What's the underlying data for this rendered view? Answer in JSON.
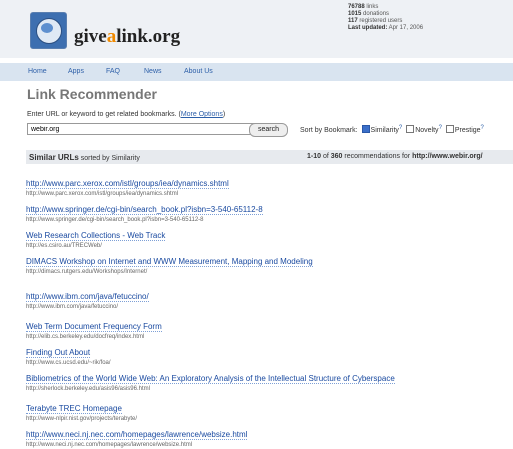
{
  "header": {
    "site_name_part1": "give",
    "site_name_part2": "a",
    "site_name_part3": "link.org",
    "stats": {
      "links": "76788",
      "links_label": " links",
      "donations": "1015",
      "donations_label": " donations",
      "users": "117",
      "users_label": " registered users",
      "updated_label": "Last updated:",
      "updated_value": " Apr 17, 2006"
    }
  },
  "nav": [
    "Home",
    "Apps",
    "FAQ",
    "News",
    "About Us"
  ],
  "page_title": "Link Recommender",
  "enter": {
    "prefix": "Enter URL or keyword to get related bookmarks. (",
    "link": "More Options",
    "suffix": ")"
  },
  "search": {
    "value": "webir.org",
    "button": "search"
  },
  "sort": {
    "label": "Sort by Bookmark:",
    "options": [
      {
        "label": "Similarity",
        "checked": true
      },
      {
        "label": "Novelty",
        "checked": false
      },
      {
        "label": "Prestige",
        "checked": false
      }
    ],
    "help": "?"
  },
  "results_header": {
    "title": "Similar URLs",
    "subtitle": " sorted by Similarity",
    "range": "1-10",
    "of": " of ",
    "total": "360",
    "mid": " recommendations for ",
    "target": "http://www.webir.org/"
  },
  "results": [
    {
      "title": "http://www.parc.xerox.com/istl/groups/iea/dynamics.shtml",
      "url": "http://www.parc.xerox.com/istl/groups/iea/dynamics.shtml"
    },
    {
      "title": "http://www.springer.de/cgi-bin/search_book.pl?isbn=3-540-65112-8",
      "url": "http://www.springer.de/cgi-bin/search_book.pl?isbn=3-540-65112-8"
    },
    {
      "title": "Web Research Collections - Web Track",
      "url": "http://es.csiro.au/TRECWeb/"
    },
    {
      "title": "DIMACS Workshop on Internet and WWW Measurement, Mapping and Modeling",
      "url": "http://dimacs.rutgers.edu/Workshops/Internet/"
    },
    {
      "title": "http://www.ibm.com/java/fetuccino/",
      "url": "http://www.ibm.com/java/fetuccino/"
    },
    {
      "title": "Web Term Document Frequency Form",
      "url": "http://elib.cs.berkeley.edu/docfreq/index.html"
    },
    {
      "title": "Finding Out About",
      "url": "http://www.cs.ucsd.edu/~rik/foa/"
    },
    {
      "title": "Bibliometrics of the World Wide Web: An Exploratory Analysis of the Intellectual Structure of Cyberspace",
      "url": "http://sherlock.berkeley.edu/asis96/asis96.html"
    },
    {
      "title": "Terabyte TREC Homepage",
      "url": "http://www-nlpir.nist.gov/projects/terabyte/"
    },
    {
      "title": "http://www.neci.nj.nec.com/homepages/lawrence/websize.html",
      "url": "http://www.neci.nj.nec.com/homepages/lawrence/websize.html"
    }
  ]
}
